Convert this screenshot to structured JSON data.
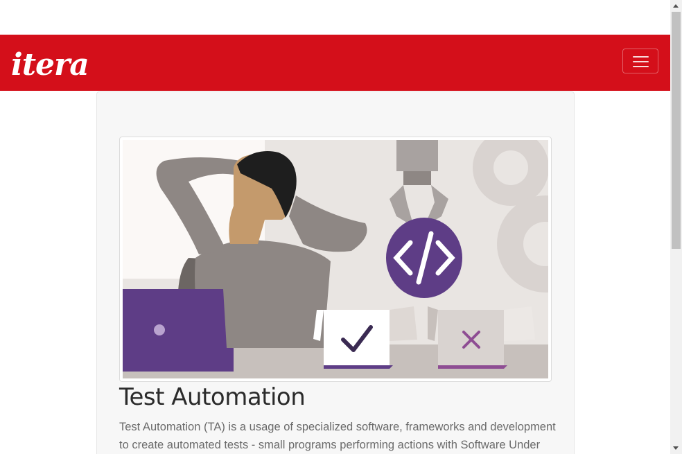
{
  "header": {
    "logo_text": "itera",
    "menu_icon": "hamburger-icon",
    "brand_color": "#d40f1a"
  },
  "card": {
    "image_alt": "test-automation-illustration",
    "title": "Test Automation",
    "description": "Test Automation (TA) is a usage of specialized software, frameworks and development to create automated tests - small programs performing actions with Software Under Test"
  },
  "colors": {
    "accent_purple": "#5e3d86",
    "background": "#ffffff",
    "card_background": "#f7f7f7"
  }
}
